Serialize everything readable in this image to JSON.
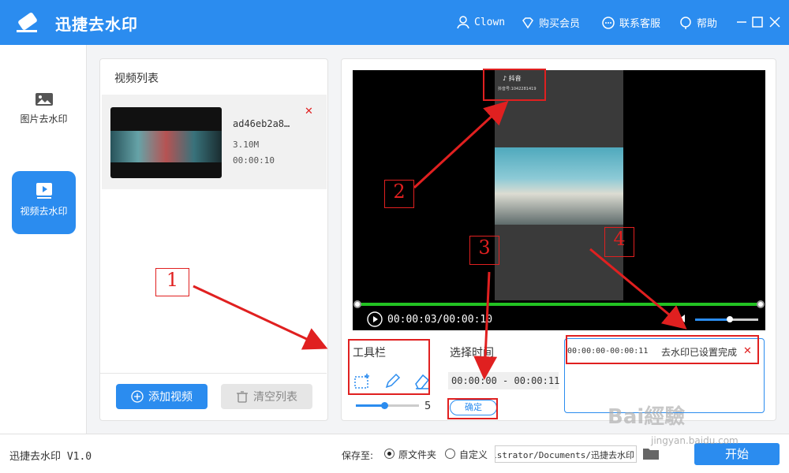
{
  "app": {
    "title": "迅捷去水印",
    "version": "迅捷去水印 V1.0"
  },
  "titlebar": {
    "user": "Clown",
    "buy_vip": "购买会员",
    "support": "联系客服",
    "help": "帮助"
  },
  "sidebar": {
    "items": [
      {
        "label": "图片去水印",
        "icon": "image-icon",
        "active": false
      },
      {
        "label": "视频去水印",
        "icon": "video-icon",
        "active": true
      }
    ]
  },
  "video_list": {
    "title": "视频列表",
    "items": [
      {
        "name": "ad46eb2a8…",
        "size": "3.10M",
        "duration": "00:00:10"
      }
    ],
    "add_button": "添加视频",
    "clear_button": "清空列表"
  },
  "player": {
    "time": "00:00:03/00:00:10",
    "progress": 1.0,
    "volume": 0.55,
    "watermark_text": "抖音",
    "watermark_id": "抖音号:1042281419"
  },
  "toolbar": {
    "label": "工具栏",
    "tools": [
      "select-rect-icon",
      "pen-icon",
      "eraser-icon"
    ],
    "brush_size": "5",
    "brush_level": 0.45
  },
  "time_select": {
    "label": "选择时间",
    "start": "00:00:00",
    "separator": "-",
    "end": "00:00:11",
    "confirm": "确定"
  },
  "results": {
    "items": [
      {
        "range": "00:00:00-00:00:11",
        "status": "去水印已设置完成"
      }
    ]
  },
  "footer": {
    "save_to": "保存至:",
    "options": [
      "原文件夹",
      "自定义"
    ],
    "selected": "原文件夹",
    "path": "C:/Users/Administrator/Documents/迅捷去水印",
    "start": "开始"
  },
  "annotations": [
    "1",
    "2",
    "3",
    "4"
  ],
  "watermark": {
    "brand": "Bai經驗",
    "url": "jingyan.baidu.com"
  },
  "colors": {
    "brand": "#2b8cef",
    "annotation": "#e02020",
    "progress": "#22c322"
  }
}
